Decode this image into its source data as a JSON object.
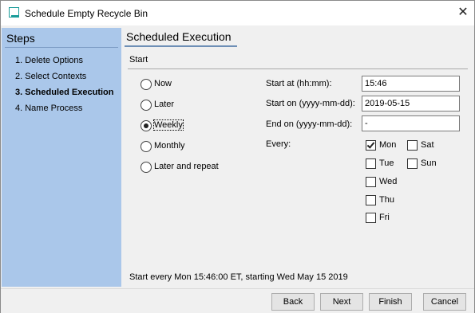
{
  "window": {
    "title": "Schedule Empty Recycle Bin",
    "close_glyph": "✕"
  },
  "sidebar": {
    "title": "Steps",
    "steps": [
      {
        "label": "1. Delete Options"
      },
      {
        "label": "2. Select Contexts"
      },
      {
        "label": "3. Scheduled Execution",
        "active": true
      },
      {
        "label": "4. Name Process"
      }
    ]
  },
  "main": {
    "title": "Scheduled Execution",
    "group_label": "Start",
    "options": [
      {
        "label": "Now",
        "checked": false
      },
      {
        "label": "Later",
        "checked": false
      },
      {
        "label": "Weekly",
        "checked": true
      },
      {
        "label": "Monthly",
        "checked": false
      },
      {
        "label": "Later and repeat",
        "checked": false
      }
    ],
    "start_at": {
      "label": "Start at (hh:mm):",
      "value": "15:46"
    },
    "start_on": {
      "label": "Start on (yyyy-mm-dd):",
      "value": "2019-05-15"
    },
    "end_on": {
      "label": "End on (yyyy-mm-dd):",
      "value": "-"
    },
    "every_label": "Every:",
    "days": [
      {
        "label": "Mon",
        "checked": true
      },
      {
        "label": "Tue",
        "checked": false
      },
      {
        "label": "Wed",
        "checked": false
      },
      {
        "label": "Thu",
        "checked": false
      },
      {
        "label": "Fri",
        "checked": false
      },
      {
        "label": "Sat",
        "checked": false
      },
      {
        "label": "Sun",
        "checked": false
      }
    ],
    "summary": "Start every Mon 15:46:00 ET, starting Wed May 15 2019"
  },
  "buttons": {
    "back": "Back",
    "next": "Next",
    "finish": "Finish",
    "cancel": "Cancel"
  }
}
